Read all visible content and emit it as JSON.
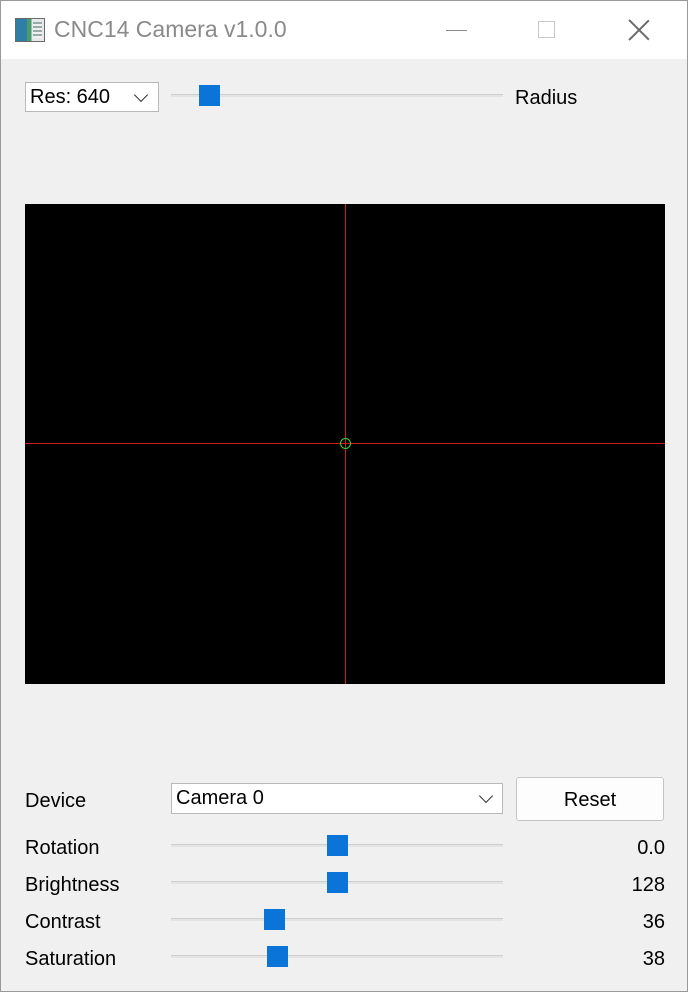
{
  "window": {
    "title": "CNC14 Camera v1.0.0"
  },
  "top_controls": {
    "resolution": {
      "selected": "Res: 640"
    },
    "radius": {
      "label": "Radius",
      "level": 0.09
    }
  },
  "viewer": {
    "crosshair_color": "#d11a1a",
    "center_circle_color": "#35d635"
  },
  "device": {
    "label": "Device",
    "selected": "Camera 0"
  },
  "reset_label": "Reset",
  "adjustments": {
    "rotation": {
      "label": "Rotation",
      "value": "0.0",
      "level": 0.5
    },
    "brightness": {
      "label": "Brightness",
      "value": "128",
      "level": 0.502
    },
    "contrast": {
      "label": "Contrast",
      "value": "36",
      "level": 0.3
    },
    "saturation": {
      "label": "Saturation",
      "value": "38",
      "level": 0.31
    }
  },
  "colors": {
    "accent": "#0a74d9",
    "background": "#f0f0f0"
  }
}
